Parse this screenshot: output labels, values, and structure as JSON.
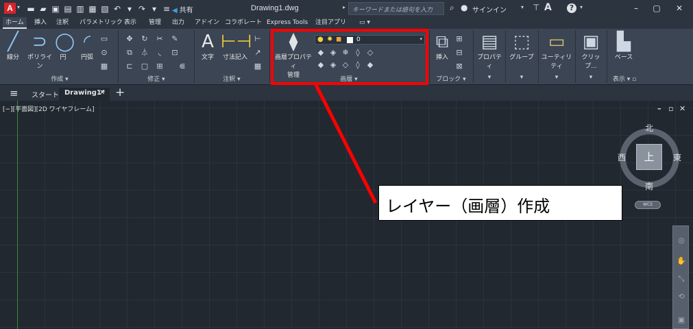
{
  "app": {
    "logo": "A",
    "share_label": "共有",
    "document_title": "Drawing1.dwg",
    "search_placeholder": "キーワードまたは語句を入力",
    "signin_label": "サインイン"
  },
  "ribbon_tabs": [
    "ホーム",
    "挿入",
    "注釈",
    "パラメトリック",
    "表示",
    "管理",
    "出力",
    "アドイン",
    "コラボレート",
    "Express Tools",
    "注目アプリ"
  ],
  "ribbon": {
    "draw": {
      "line": "線分",
      "polyline": "ポリライン",
      "circle": "円",
      "arc": "円弧",
      "footer": "作成 ▾"
    },
    "modify": {
      "footer": "修正 ▾"
    },
    "annotation": {
      "text": "文字",
      "dimension": "寸法記入",
      "footer": "注釈 ▾"
    },
    "layers": {
      "properties_line1": "画層プロパティ",
      "properties_line2": "管理",
      "current_layer": "0",
      "footer": "画層 ▾"
    },
    "block": {
      "insert": "挿入",
      "footer": "ブロック ▾"
    },
    "properties": {
      "label": "プロパティ",
      "footer": "▾"
    },
    "groups": {
      "label": "グループ",
      "footer": "▾"
    },
    "utilities": {
      "label": "ユーティリティ",
      "footer": "▾"
    },
    "clipboard": {
      "label": "クリップ...",
      "footer": "▾"
    },
    "base": {
      "label": "ベース",
      "footer": "表示 ▾ ▫"
    }
  },
  "file_tabs": {
    "start": "スタート",
    "drawing": "Drawing1*"
  },
  "viewport": {
    "label": "[−][平面図][2D ワイヤフレーム]"
  },
  "viewcube": {
    "north": "北",
    "south": "南",
    "west": "西",
    "east": "東",
    "top": "上",
    "wcs": "WCS"
  },
  "annotation": {
    "callout_text": "レイヤー（画層）作成",
    "color": "#ff0000"
  }
}
